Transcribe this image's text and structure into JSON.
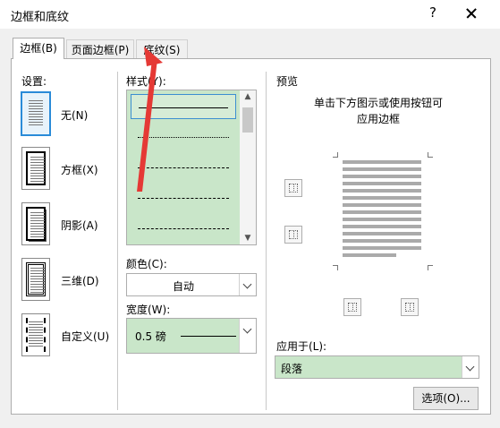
{
  "window": {
    "title": "边框和底纹",
    "help": "?",
    "close": "×"
  },
  "tabs": [
    {
      "label": "边框(B)"
    },
    {
      "label": "页面边框(P)"
    },
    {
      "label": "底纹(S)"
    }
  ],
  "settings": {
    "header": "设置:",
    "items": [
      {
        "label": "无(N)",
        "icon": "none-border-icon"
      },
      {
        "label": "方框(X)",
        "icon": "box-border-icon"
      },
      {
        "label": "阴影(A)",
        "icon": "shadow-border-icon"
      },
      {
        "label": "三维(D)",
        "icon": "3d-border-icon"
      },
      {
        "label": "自定义(U)",
        "icon": "custom-border-icon"
      }
    ]
  },
  "style": {
    "label": "样式(Y):",
    "selected_index": 0
  },
  "color": {
    "label": "颜色(C):",
    "value": "自动"
  },
  "width": {
    "label": "宽度(W):",
    "value": "0.5 磅"
  },
  "preview": {
    "header": "预览",
    "hint_line1": "单击下方图示或使用按钮可",
    "hint_line2": "应用边框"
  },
  "apply_to": {
    "label": "应用于(L):",
    "value": "段落"
  },
  "options_button": "选项(O)...",
  "colors": {
    "highlight_green": "#c9e6c9",
    "selection_blue": "#3c8ed1",
    "annotation_red": "#e53935"
  }
}
